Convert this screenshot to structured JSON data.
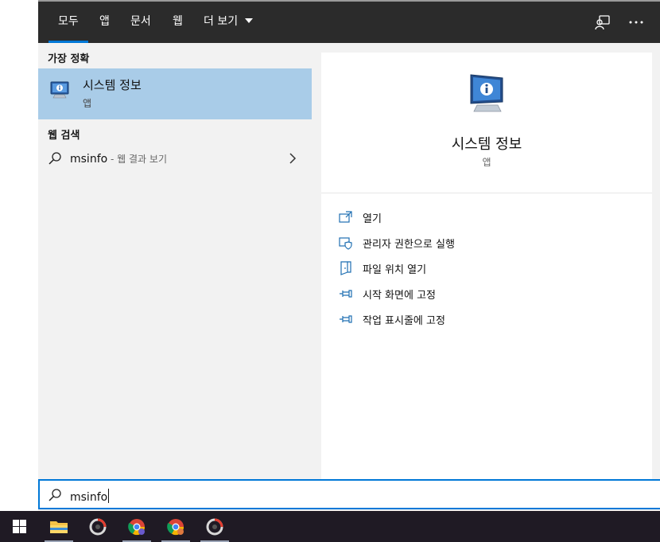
{
  "header": {
    "tabs": [
      {
        "label": "모두"
      },
      {
        "label": "앱"
      },
      {
        "label": "문서"
      },
      {
        "label": "웹"
      },
      {
        "label": "더 보기"
      }
    ]
  },
  "results": {
    "best_match_label": "가장 정확",
    "best_match": {
      "name": "시스템 정보",
      "type": "앱"
    },
    "web_search_label": "웹 검색",
    "web": {
      "query": "msinfo",
      "suffix": " - 웹 결과 보기"
    }
  },
  "preview": {
    "title": "시스템 정보",
    "subtitle": "앱",
    "actions": [
      {
        "label": "열기",
        "icon": "open-icon"
      },
      {
        "label": "관리자 권한으로 실행",
        "icon": "run-as-admin-icon"
      },
      {
        "label": "파일 위치 열기",
        "icon": "file-location-icon"
      },
      {
        "label": "시작 화면에 고정",
        "icon": "pin-icon"
      },
      {
        "label": "작업 표시줄에 고정",
        "icon": "pin-icon"
      }
    ]
  },
  "search": {
    "value": "msinfo"
  },
  "colors": {
    "accent": "#0078d7",
    "header_bg": "#2b2b2b",
    "selected_bg": "#a9cce8",
    "taskbar_bg": "#1f1a24"
  }
}
